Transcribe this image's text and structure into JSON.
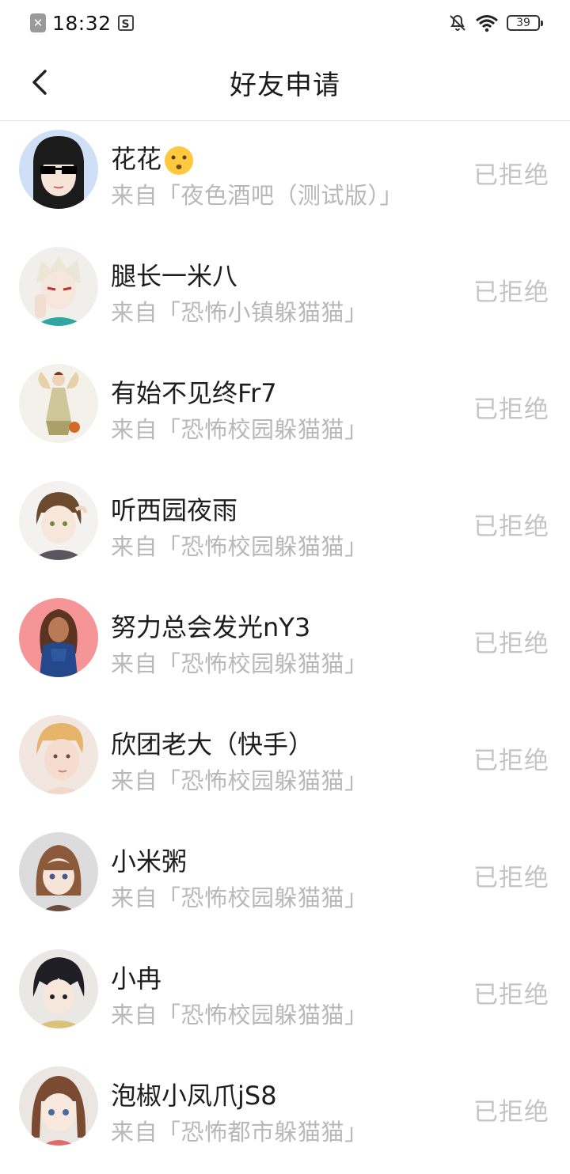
{
  "status_bar": {
    "time": "18:32",
    "battery": "39"
  },
  "header": {
    "title": "好友申请"
  },
  "requests": [
    {
      "name": "花花",
      "source": "来自「夜色酒吧（测试版）」",
      "status": "已拒绝"
    },
    {
      "name": "腿长一米八",
      "source": "来自「恐怖小镇躲猫猫」",
      "status": "已拒绝"
    },
    {
      "name": "有始不见终Fr7",
      "source": "来自「恐怖校园躲猫猫」",
      "status": "已拒绝"
    },
    {
      "name": "听西园夜雨",
      "source": "来自「恐怖校园躲猫猫」",
      "status": "已拒绝"
    },
    {
      "name": "努力总会发光nY3",
      "source": "来自「恐怖校园躲猫猫」",
      "status": "已拒绝"
    },
    {
      "name": "欣团老大（快手）",
      "source": "来自「恐怖校园躲猫猫」",
      "status": "已拒绝"
    },
    {
      "name": "小米粥",
      "source": "来自「恐怖校园躲猫猫」",
      "status": "已拒绝"
    },
    {
      "name": "小冉",
      "source": "来自「恐怖校园躲猫猫」",
      "status": "已拒绝"
    },
    {
      "name": "泡椒小凤爪jS8",
      "source": "来自「恐怖都市躲猫猫」",
      "status": "已拒绝"
    }
  ]
}
